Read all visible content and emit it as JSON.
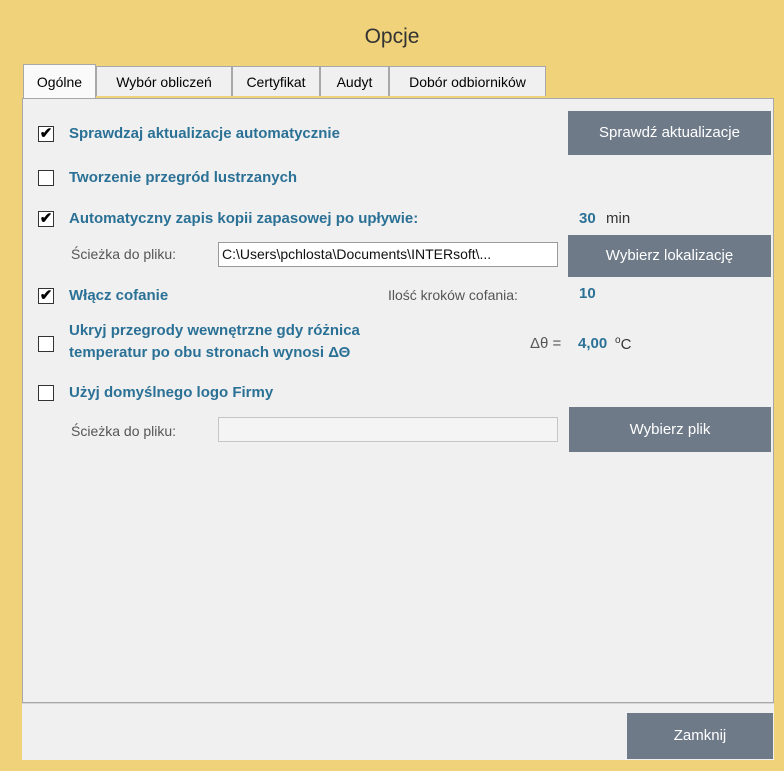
{
  "window": {
    "title": "Opcje"
  },
  "tabs": [
    {
      "label": "Ogólne",
      "active": true
    },
    {
      "label": "Wybór obliczeń",
      "active": false
    },
    {
      "label": "Certyfikat",
      "active": false
    },
    {
      "label": "Audyt",
      "active": false
    },
    {
      "label": "Dobór odbiorników",
      "active": false
    }
  ],
  "options": {
    "auto_update": {
      "label": "Sprawdzaj aktualizacje automatycznie",
      "checked": true,
      "check_glyph": "✔",
      "button": "Sprawdź aktualizacje"
    },
    "mirror_partitions": {
      "label": "Tworzenie przegród lustrzanych",
      "checked": false
    },
    "auto_backup": {
      "label": "Automatyczny zapis kopii zapasowej po upływie:",
      "checked": true,
      "check_glyph": "✔",
      "value": "30",
      "unit": "min",
      "path_label": "Ścieżka do pliku:",
      "path_value": "C:\\Users\\pchlosta\\Documents\\INTERsoft\\...",
      "button": "Wybierz lokalizację"
    },
    "undo": {
      "label": "Włącz cofanie",
      "checked": true,
      "check_glyph": "✔",
      "steps_label": "Ilość kroków cofania:",
      "steps_value": "10"
    },
    "hide_internal": {
      "label_line1": "Ukryj przegrody wewnętrzne gdy różnica",
      "label_line2": "temperatur po obu stronach wynosi ΔΘ",
      "checked": false,
      "delta_label": "Δθ =",
      "delta_value": "4,00",
      "delta_unit_sup": "o",
      "delta_unit": "C"
    },
    "default_logo": {
      "label": "Użyj domyślnego logo Firmy",
      "checked": false,
      "path_label": "Ścieżka do pliku:",
      "path_value": "",
      "button": "Wybierz plik"
    }
  },
  "footer": {
    "close_button": "Zamknij"
  },
  "colors": {
    "accent_text": "#2b7196",
    "button_bg": "#6e7a88",
    "window_bg": "#efd27a"
  }
}
